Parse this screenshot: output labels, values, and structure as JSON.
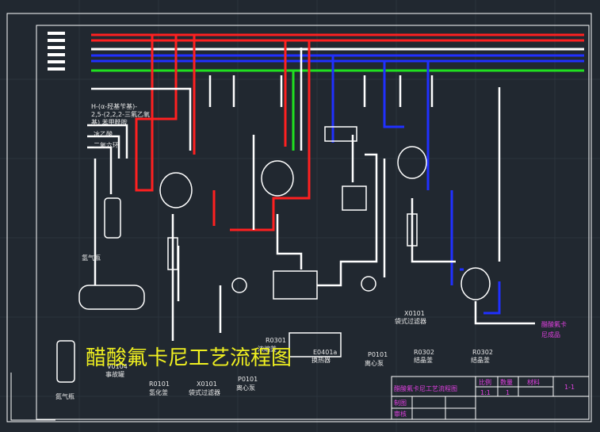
{
  "title": "醋酸氟卡尼工艺流程图",
  "feeds": [
    "H-(α-羟基苄基)-",
    "2,5-(2,2,2-三氟乙氧",
    "基) 苯甲酰胺",
    "冰乙酸",
    "二氧六环"
  ],
  "equipment": [
    {
      "tag": "V0104",
      "name": "事故罐"
    },
    {
      "tag": "R0101",
      "name": "氢化釜"
    },
    {
      "tag": "X0101",
      "name": "袋式过滤器"
    },
    {
      "tag": "P0101",
      "name": "离心泵"
    },
    {
      "tag": "R0301",
      "name": "浓缩釜"
    },
    {
      "tag": "E0401a",
      "name": "换热器"
    },
    {
      "tag": "X0101",
      "name": "袋式过滤器"
    },
    {
      "tag": "P0101",
      "name": "离心泵"
    },
    {
      "tag": "R0302",
      "name": "结晶釜"
    },
    {
      "tag": "R0302",
      "name": "结晶釜"
    }
  ],
  "vessels": {
    "hydrogen": "氢气瓶",
    "nitrogen": "氮气瓶"
  },
  "product": [
    "醋酸氟卡",
    "尼成品"
  ],
  "title_block": {
    "name": "醋酸氟卡尼工艺流程图",
    "scale_label": "比例",
    "qty_label": "数量",
    "material_label": "材料",
    "scale": "1:1",
    "qty": "1",
    "sheet": "1-1",
    "drawn": "制图",
    "checked": "审核"
  },
  "colors": {
    "background": "#212830",
    "hot": "#ff2020",
    "cold": "#2030ff",
    "green": "#20e020",
    "white": "#ffffff",
    "label": "#e040e0",
    "title": "#f0f020"
  }
}
